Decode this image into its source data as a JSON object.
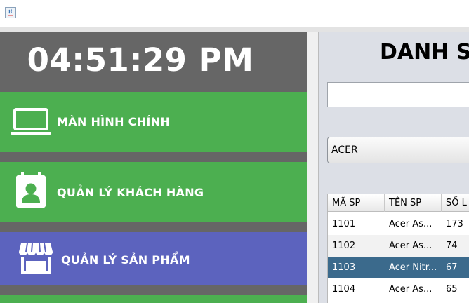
{
  "clock": "04:51:29 PM",
  "colors": {
    "nav_green": "#4caf50",
    "nav_active": "#5c63be",
    "sidebar_bg": "#666666",
    "row_selected": "#3b6a8c"
  },
  "nav": [
    {
      "label": "MÀN HÌNH CHÍNH",
      "icon": "laptop-icon"
    },
    {
      "label": "QUẢN LÝ KHÁCH HÀNG",
      "icon": "contact-card-icon"
    },
    {
      "label": "QUẢN LÝ SẢN PHẨM",
      "icon": "store-icon",
      "active": true
    }
  ],
  "panel": {
    "title": "DANH SÁ",
    "search_value": "",
    "filter_selected": "ACER"
  },
  "table": {
    "columns": [
      "MÃ SP",
      "TÊN SP",
      "SỐ L"
    ],
    "rows": [
      [
        "1101",
        "Acer As...",
        "173"
      ],
      [
        "1102",
        "Acer As...",
        "74"
      ],
      [
        "1103",
        "Acer Nitr...",
        "67"
      ],
      [
        "1104",
        "Acer As...",
        "65"
      ]
    ],
    "selected_row": 2
  }
}
